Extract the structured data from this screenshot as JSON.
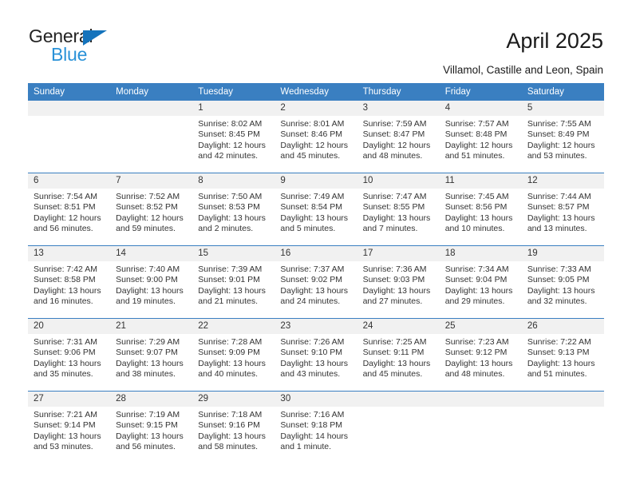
{
  "brand": {
    "name_dark": "General",
    "name_blue": "Blue",
    "color_dark": "#232323",
    "color_blue": "#2a92d8",
    "triangle_color": "#1473bc"
  },
  "header": {
    "title": "April 2025",
    "location": "Villamol, Castille and Leon, Spain"
  },
  "theme": {
    "header_bg": "#3a7fc1",
    "header_text": "#ffffff",
    "daynum_bg": "#f1f1f1",
    "grid_line": "#3a7fc1",
    "body_text": "#333333"
  },
  "calendar": {
    "weekday_headers": [
      "Sunday",
      "Monday",
      "Tuesday",
      "Wednesday",
      "Thursday",
      "Friday",
      "Saturday"
    ],
    "weeks": [
      [
        {
          "day": "",
          "lines": []
        },
        {
          "day": "",
          "lines": []
        },
        {
          "day": "1",
          "lines": [
            "Sunrise: 8:02 AM",
            "Sunset: 8:45 PM",
            "Daylight: 12 hours",
            "and 42 minutes."
          ]
        },
        {
          "day": "2",
          "lines": [
            "Sunrise: 8:01 AM",
            "Sunset: 8:46 PM",
            "Daylight: 12 hours",
            "and 45 minutes."
          ]
        },
        {
          "day": "3",
          "lines": [
            "Sunrise: 7:59 AM",
            "Sunset: 8:47 PM",
            "Daylight: 12 hours",
            "and 48 minutes."
          ]
        },
        {
          "day": "4",
          "lines": [
            "Sunrise: 7:57 AM",
            "Sunset: 8:48 PM",
            "Daylight: 12 hours",
            "and 51 minutes."
          ]
        },
        {
          "day": "5",
          "lines": [
            "Sunrise: 7:55 AM",
            "Sunset: 8:49 PM",
            "Daylight: 12 hours",
            "and 53 minutes."
          ]
        }
      ],
      [
        {
          "day": "6",
          "lines": [
            "Sunrise: 7:54 AM",
            "Sunset: 8:51 PM",
            "Daylight: 12 hours",
            "and 56 minutes."
          ]
        },
        {
          "day": "7",
          "lines": [
            "Sunrise: 7:52 AM",
            "Sunset: 8:52 PM",
            "Daylight: 12 hours",
            "and 59 minutes."
          ]
        },
        {
          "day": "8",
          "lines": [
            "Sunrise: 7:50 AM",
            "Sunset: 8:53 PM",
            "Daylight: 13 hours",
            "and 2 minutes."
          ]
        },
        {
          "day": "9",
          "lines": [
            "Sunrise: 7:49 AM",
            "Sunset: 8:54 PM",
            "Daylight: 13 hours",
            "and 5 minutes."
          ]
        },
        {
          "day": "10",
          "lines": [
            "Sunrise: 7:47 AM",
            "Sunset: 8:55 PM",
            "Daylight: 13 hours",
            "and 7 minutes."
          ]
        },
        {
          "day": "11",
          "lines": [
            "Sunrise: 7:45 AM",
            "Sunset: 8:56 PM",
            "Daylight: 13 hours",
            "and 10 minutes."
          ]
        },
        {
          "day": "12",
          "lines": [
            "Sunrise: 7:44 AM",
            "Sunset: 8:57 PM",
            "Daylight: 13 hours",
            "and 13 minutes."
          ]
        }
      ],
      [
        {
          "day": "13",
          "lines": [
            "Sunrise: 7:42 AM",
            "Sunset: 8:58 PM",
            "Daylight: 13 hours",
            "and 16 minutes."
          ]
        },
        {
          "day": "14",
          "lines": [
            "Sunrise: 7:40 AM",
            "Sunset: 9:00 PM",
            "Daylight: 13 hours",
            "and 19 minutes."
          ]
        },
        {
          "day": "15",
          "lines": [
            "Sunrise: 7:39 AM",
            "Sunset: 9:01 PM",
            "Daylight: 13 hours",
            "and 21 minutes."
          ]
        },
        {
          "day": "16",
          "lines": [
            "Sunrise: 7:37 AM",
            "Sunset: 9:02 PM",
            "Daylight: 13 hours",
            "and 24 minutes."
          ]
        },
        {
          "day": "17",
          "lines": [
            "Sunrise: 7:36 AM",
            "Sunset: 9:03 PM",
            "Daylight: 13 hours",
            "and 27 minutes."
          ]
        },
        {
          "day": "18",
          "lines": [
            "Sunrise: 7:34 AM",
            "Sunset: 9:04 PM",
            "Daylight: 13 hours",
            "and 29 minutes."
          ]
        },
        {
          "day": "19",
          "lines": [
            "Sunrise: 7:33 AM",
            "Sunset: 9:05 PM",
            "Daylight: 13 hours",
            "and 32 minutes."
          ]
        }
      ],
      [
        {
          "day": "20",
          "lines": [
            "Sunrise: 7:31 AM",
            "Sunset: 9:06 PM",
            "Daylight: 13 hours",
            "and 35 minutes."
          ]
        },
        {
          "day": "21",
          "lines": [
            "Sunrise: 7:29 AM",
            "Sunset: 9:07 PM",
            "Daylight: 13 hours",
            "and 38 minutes."
          ]
        },
        {
          "day": "22",
          "lines": [
            "Sunrise: 7:28 AM",
            "Sunset: 9:09 PM",
            "Daylight: 13 hours",
            "and 40 minutes."
          ]
        },
        {
          "day": "23",
          "lines": [
            "Sunrise: 7:26 AM",
            "Sunset: 9:10 PM",
            "Daylight: 13 hours",
            "and 43 minutes."
          ]
        },
        {
          "day": "24",
          "lines": [
            "Sunrise: 7:25 AM",
            "Sunset: 9:11 PM",
            "Daylight: 13 hours",
            "and 45 minutes."
          ]
        },
        {
          "day": "25",
          "lines": [
            "Sunrise: 7:23 AM",
            "Sunset: 9:12 PM",
            "Daylight: 13 hours",
            "and 48 minutes."
          ]
        },
        {
          "day": "26",
          "lines": [
            "Sunrise: 7:22 AM",
            "Sunset: 9:13 PM",
            "Daylight: 13 hours",
            "and 51 minutes."
          ]
        }
      ],
      [
        {
          "day": "27",
          "lines": [
            "Sunrise: 7:21 AM",
            "Sunset: 9:14 PM",
            "Daylight: 13 hours",
            "and 53 minutes."
          ]
        },
        {
          "day": "28",
          "lines": [
            "Sunrise: 7:19 AM",
            "Sunset: 9:15 PM",
            "Daylight: 13 hours",
            "and 56 minutes."
          ]
        },
        {
          "day": "29",
          "lines": [
            "Sunrise: 7:18 AM",
            "Sunset: 9:16 PM",
            "Daylight: 13 hours",
            "and 58 minutes."
          ]
        },
        {
          "day": "30",
          "lines": [
            "Sunrise: 7:16 AM",
            "Sunset: 9:18 PM",
            "Daylight: 14 hours",
            "and 1 minute."
          ]
        },
        {
          "day": "",
          "lines": []
        },
        {
          "day": "",
          "lines": []
        },
        {
          "day": "",
          "lines": []
        }
      ]
    ]
  }
}
